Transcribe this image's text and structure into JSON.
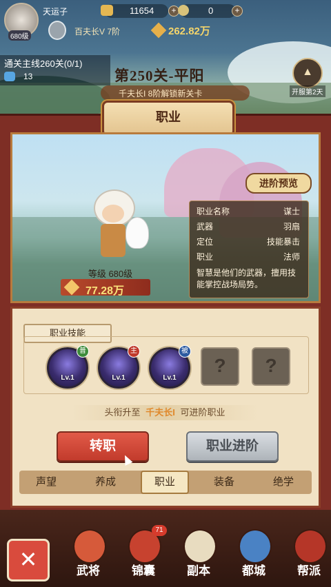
{
  "player": {
    "name": "天运子",
    "level": "680级",
    "title": "百夫长V 7阶",
    "power": "262.82万"
  },
  "currency": {
    "gold": "11654",
    "tokens": "0"
  },
  "quest": {
    "label": "通关主线260关(0/1)",
    "count": "13"
  },
  "stage": {
    "title": "第250关-平阳",
    "unlock_hint": "千夫长I 8阶解锁新关卡",
    "right_label": "开服第2天"
  },
  "panel": {
    "title": "职业",
    "preview_button": "进阶预览"
  },
  "hero": {
    "level_label": "等级 680级",
    "power": "77.28万"
  },
  "profession_info": {
    "rows": [
      {
        "key": "职业名称",
        "value": "谋士"
      },
      {
        "key": "武器",
        "value": "羽扇"
      },
      {
        "key": "定位",
        "value": "技能暴击"
      },
      {
        "key": "职业",
        "value": "法师"
      }
    ],
    "description": "智慧是他们的武器，擅用技能掌控战场局势。"
  },
  "skills": {
    "section_label": "职业技能",
    "items": [
      {
        "tag": "普",
        "level": "Lv.1",
        "tag_color": "#3d8b3a"
      },
      {
        "tag": "主",
        "level": "Lv.1",
        "tag_color": "#c0392b"
      },
      {
        "tag": "被",
        "level": "Lv.1",
        "tag_color": "#2c5aa0"
      },
      {
        "locked": "?"
      },
      {
        "locked": "?"
      }
    ]
  },
  "advance_hint": {
    "prefix": "头衔升至",
    "highlight": "千夫长I",
    "suffix": "可进阶职业"
  },
  "buttons": {
    "change": "转职",
    "advance": "职业进阶"
  },
  "tabs": [
    "声望",
    "养成",
    "职业",
    "装备",
    "绝学"
  ],
  "active_tab": "职业",
  "nav": {
    "close_icon": "close-icon",
    "items": [
      {
        "label": "武将",
        "icon": "general-icon"
      },
      {
        "label": "锦囊",
        "icon": "pouch-icon",
        "badge": "71"
      },
      {
        "label": "副本",
        "icon": "scroll-icon"
      },
      {
        "label": "都城",
        "icon": "city-icon"
      },
      {
        "label": "帮派",
        "icon": "guild-icon"
      }
    ]
  },
  "colors": {
    "accent_red": "#d8493b",
    "gold_text": "#f5d56b",
    "highlight_text": "#e0892c"
  }
}
